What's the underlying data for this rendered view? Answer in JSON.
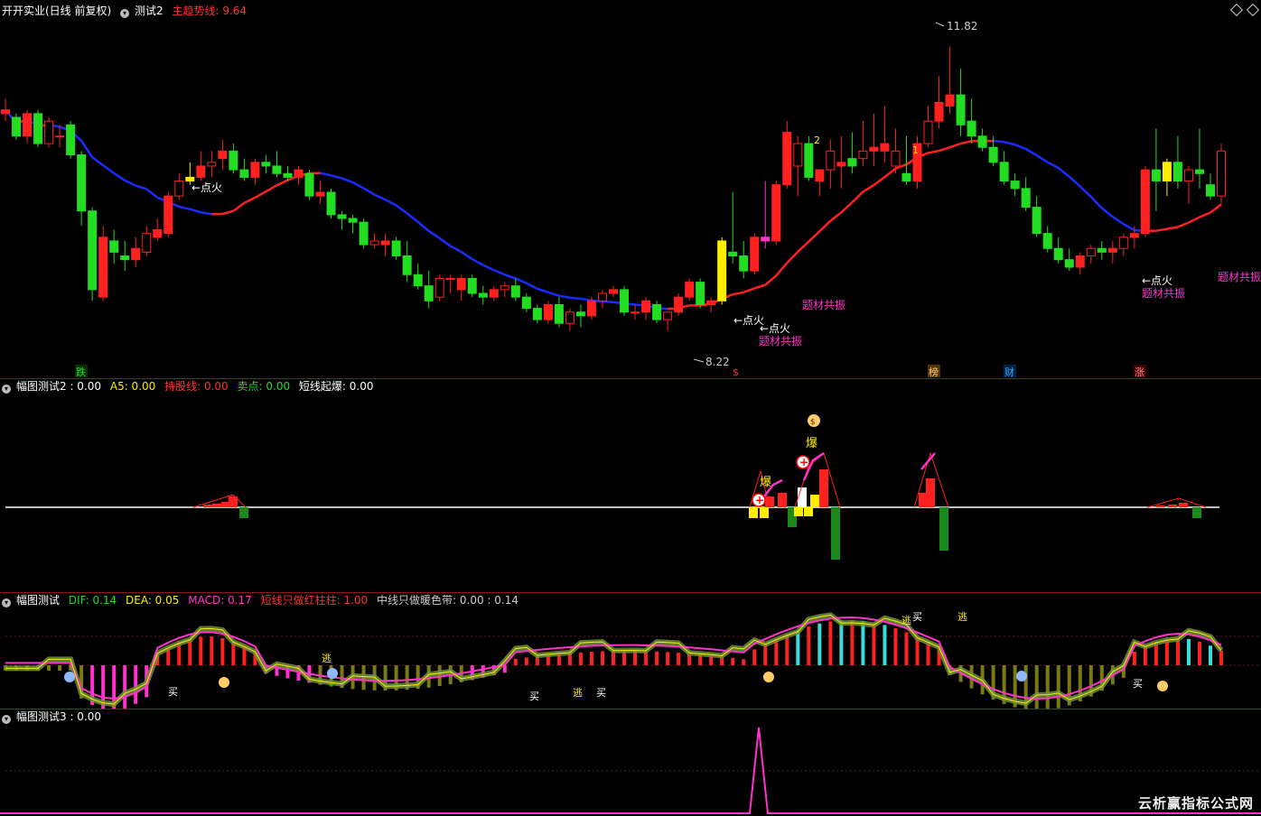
{
  "main_header": {
    "stock": "开开实业(日线 前复权)",
    "indicator": "测试2",
    "label": "主趋势线: 9.64"
  },
  "sub1_header": {
    "name": "幅图测试2 : 0.00",
    "a5": "A5: 0.00",
    "hold": "持股线: 0.00",
    "sell": "卖点: 0.00",
    "burst": "短线起爆: 0.00"
  },
  "sub2_header": {
    "name": "幅图测试",
    "dif": "DIF: 0.14",
    "dea": "DEA: 0.05",
    "macd": "MACD: 0.17",
    "short": "短线只做红柱柱: 1.00",
    "mid": "中线只做暖色带: 0.00 : 0.14"
  },
  "sub3_header": {
    "name": "幅图测试3 : 0.00"
  },
  "watermark": "云析赢指标公式网",
  "colors": {
    "up": "#ff2020",
    "down": "#22dd22",
    "trend_up": "#ff2020",
    "trend_down": "#1a2cff",
    "magenta": "#ff33cc",
    "yellow": "#ffee00",
    "axis": "#8a1a1a"
  },
  "chart_data": [
    {
      "type": "candlestick",
      "price_range": [
        7.5,
        12.2
      ],
      "annotations": {
        "high_label": "11.82",
        "low_label": "8.22",
        "fire": "←点火",
        "theme": "题材共振",
        "num1": "1",
        "num2": "2",
        "events": [
          "跌",
          "$",
          "榜",
          "财",
          "涨"
        ]
      },
      "candles_ohlc": [
        [
          10.9,
          11.1,
          10.8,
          10.95
        ],
        [
          10.85,
          10.9,
          10.55,
          10.6
        ],
        [
          10.6,
          10.95,
          10.5,
          10.9
        ],
        [
          10.9,
          10.95,
          10.45,
          10.5
        ],
        [
          10.5,
          10.85,
          10.45,
          10.8
        ],
        [
          10.6,
          10.75,
          10.45,
          10.6
        ],
        [
          10.75,
          10.8,
          10.3,
          10.35
        ],
        [
          10.35,
          10.4,
          9.4,
          9.6
        ],
        [
          9.6,
          9.65,
          8.4,
          8.55
        ],
        [
          8.45,
          9.4,
          8.4,
          9.25
        ],
        [
          9.2,
          9.35,
          8.9,
          9.05
        ],
        [
          9.0,
          9.2,
          8.8,
          8.95
        ],
        [
          8.95,
          9.25,
          8.85,
          9.1
        ],
        [
          9.05,
          9.4,
          9.0,
          9.3
        ],
        [
          9.25,
          9.5,
          9.2,
          9.35
        ],
        [
          9.3,
          9.85,
          9.25,
          9.8
        ],
        [
          9.8,
          10.1,
          9.75,
          10.0
        ],
        [
          10.0,
          10.25,
          9.95,
          10.05
        ],
        [
          10.05,
          10.4,
          10.0,
          10.2
        ],
        [
          10.2,
          10.4,
          10.05,
          10.25
        ],
        [
          10.3,
          10.55,
          10.15,
          10.4
        ],
        [
          10.4,
          10.5,
          10.1,
          10.15
        ],
        [
          10.15,
          10.3,
          10.0,
          10.05
        ],
        [
          10.05,
          10.3,
          9.95,
          10.25
        ],
        [
          10.25,
          10.35,
          10.1,
          10.2
        ],
        [
          10.2,
          10.4,
          10.05,
          10.1
        ],
        [
          10.1,
          10.2,
          10.0,
          10.05
        ],
        [
          10.05,
          10.2,
          9.95,
          10.15
        ],
        [
          10.1,
          10.15,
          9.75,
          9.8
        ],
        [
          9.8,
          10.0,
          9.7,
          9.85
        ],
        [
          9.85,
          9.9,
          9.5,
          9.55
        ],
        [
          9.55,
          9.6,
          9.35,
          9.5
        ],
        [
          9.5,
          9.55,
          9.3,
          9.45
        ],
        [
          9.45,
          9.5,
          9.1,
          9.15
        ],
        [
          9.15,
          9.3,
          9.1,
          9.2
        ],
        [
          9.15,
          9.3,
          9.0,
          9.2
        ],
        [
          9.2,
          9.25,
          8.95,
          9.0
        ],
        [
          9.0,
          9.2,
          8.65,
          8.75
        ],
        [
          8.75,
          8.9,
          8.55,
          8.6
        ],
        [
          8.6,
          8.8,
          8.3,
          8.4
        ],
        [
          8.45,
          8.75,
          8.4,
          8.7
        ],
        [
          8.7,
          8.75,
          8.5,
          8.7
        ],
        [
          8.55,
          8.75,
          8.4,
          8.7
        ],
        [
          8.7,
          8.75,
          8.45,
          8.5
        ],
        [
          8.5,
          8.6,
          8.35,
          8.45
        ],
        [
          8.45,
          8.6,
          8.4,
          8.55
        ],
        [
          8.55,
          8.65,
          8.45,
          8.6
        ],
        [
          8.6,
          8.7,
          8.4,
          8.45
        ],
        [
          8.45,
          8.5,
          8.25,
          8.3
        ],
        [
          8.3,
          8.35,
          8.1,
          8.15
        ],
        [
          8.15,
          8.4,
          8.1,
          8.35
        ],
        [
          8.35,
          8.45,
          8.05,
          8.1
        ],
        [
          8.1,
          8.3,
          8.0,
          8.25
        ],
        [
          8.25,
          8.35,
          8.05,
          8.2
        ],
        [
          8.2,
          8.45,
          8.15,
          8.4
        ],
        [
          8.4,
          8.55,
          8.3,
          8.5
        ],
        [
          8.5,
          8.6,
          8.45,
          8.55
        ],
        [
          8.55,
          8.6,
          8.2,
          8.25
        ],
        [
          8.25,
          8.35,
          8.15,
          8.25
        ],
        [
          8.25,
          8.45,
          8.15,
          8.4
        ],
        [
          8.35,
          8.4,
          8.1,
          8.15
        ],
        [
          8.15,
          8.25,
          8.0,
          8.25
        ],
        [
          8.25,
          8.5,
          8.2,
          8.45
        ],
        [
          8.45,
          8.7,
          8.4,
          8.65
        ],
        [
          8.65,
          8.7,
          8.3,
          8.35
        ],
        [
          8.35,
          8.45,
          8.25,
          8.4
        ],
        [
          8.4,
          9.25,
          8.35,
          9.2
        ],
        [
          9.05,
          9.85,
          8.9,
          9.0
        ],
        [
          9.0,
          9.2,
          8.7,
          8.8
        ],
        [
          8.8,
          9.3,
          8.75,
          9.25
        ],
        [
          9.25,
          10.0,
          9.1,
          9.2
        ],
        [
          9.2,
          10.0,
          9.15,
          9.95
        ],
        [
          9.95,
          10.8,
          9.9,
          10.65
        ],
        [
          10.2,
          10.6,
          9.8,
          10.5
        ],
        [
          10.5,
          10.6,
          10.0,
          10.05
        ],
        [
          10.0,
          10.1,
          9.8,
          10.15
        ],
        [
          10.15,
          10.55,
          9.9,
          10.4
        ],
        [
          10.2,
          10.6,
          9.9,
          10.25
        ],
        [
          10.3,
          10.65,
          10.1,
          10.2
        ],
        [
          10.3,
          10.8,
          10.2,
          10.4
        ],
        [
          10.4,
          10.9,
          10.2,
          10.45
        ],
        [
          10.4,
          11.0,
          10.25,
          10.5
        ],
        [
          10.2,
          10.7,
          10.1,
          10.4
        ],
        [
          10.1,
          10.6,
          9.95,
          10.0
        ],
        [
          10.0,
          10.6,
          9.9,
          10.5
        ],
        [
          10.5,
          11.0,
          10.45,
          10.8
        ],
        [
          10.8,
          11.4,
          10.7,
          11.05
        ],
        [
          11.0,
          11.8,
          10.9,
          11.15
        ],
        [
          11.15,
          11.5,
          10.6,
          10.75
        ],
        [
          10.8,
          11.1,
          10.5,
          10.6
        ],
        [
          10.6,
          10.7,
          10.4,
          10.45
        ],
        [
          10.45,
          10.6,
          10.2,
          10.25
        ],
        [
          10.25,
          10.4,
          9.95,
          10.0
        ],
        [
          10.0,
          10.1,
          9.8,
          9.9
        ],
        [
          9.9,
          10.05,
          9.6,
          9.65
        ],
        [
          9.65,
          9.8,
          9.25,
          9.3
        ],
        [
          9.3,
          9.4,
          9.05,
          9.1
        ],
        [
          9.1,
          9.25,
          8.9,
          8.95
        ],
        [
          8.95,
          9.1,
          8.8,
          8.85
        ],
        [
          8.85,
          9.05,
          8.75,
          9.0
        ],
        [
          9.0,
          9.15,
          8.9,
          9.1
        ],
        [
          9.1,
          9.2,
          8.95,
          9.05
        ],
        [
          9.05,
          9.2,
          8.9,
          9.1
        ],
        [
          9.1,
          9.3,
          9.0,
          9.25
        ],
        [
          9.25,
          9.4,
          9.1,
          9.3
        ],
        [
          9.3,
          10.2,
          9.25,
          10.15
        ],
        [
          10.15,
          10.7,
          9.6,
          10.0
        ],
        [
          10.0,
          10.3,
          9.8,
          10.25
        ],
        [
          10.25,
          10.6,
          9.9,
          10.0
        ],
        [
          10.0,
          10.2,
          9.7,
          10.15
        ],
        [
          10.15,
          10.7,
          9.9,
          10.1
        ],
        [
          9.95,
          10.1,
          9.75,
          9.8
        ],
        [
          9.8,
          10.5,
          9.7,
          10.4
        ]
      ]
    },
    {
      "type": "bar",
      "name": "幅图测试2",
      "range": [
        -1.5,
        1.8
      ]
    },
    {
      "type": "bar",
      "name": "MACD",
      "dif_last": 0.14,
      "dea_last": 0.05,
      "macd_last": 0.17,
      "labels": [
        "买",
        "逃"
      ]
    },
    {
      "type": "line",
      "name": "幅图测试3",
      "value": 0.0
    }
  ]
}
